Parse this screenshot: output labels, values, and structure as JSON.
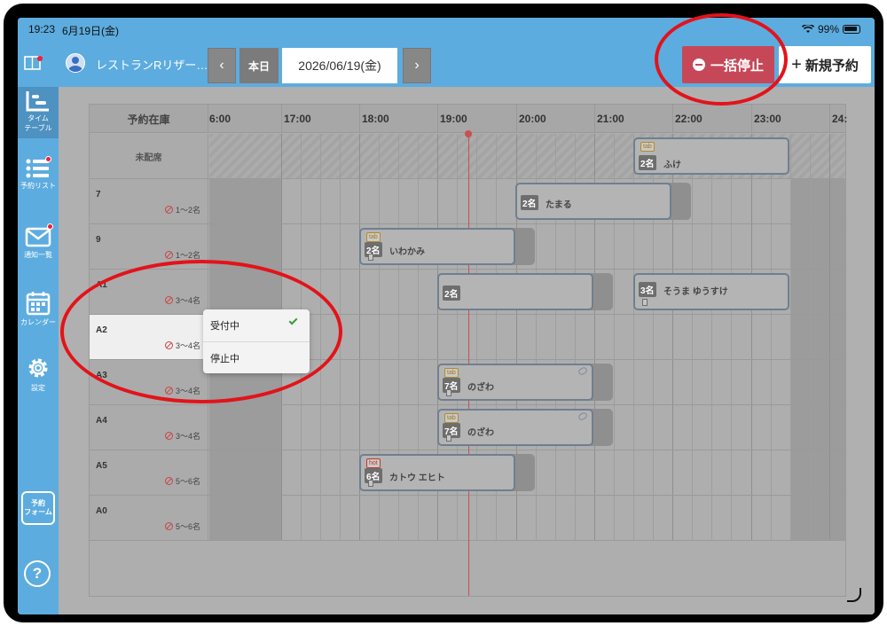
{
  "status_bar": {
    "time": "19:23",
    "date": "6月19日(金)",
    "battery": "99%"
  },
  "header": {
    "restaurant": "レストランRリザー…",
    "prev": "‹",
    "next": "›",
    "today": "本日",
    "date": "2026/06/19(金)",
    "stop_all": "一括停止",
    "new_reservation_plus": "+",
    "new_reservation": "新規予約"
  },
  "sidebar": {
    "items": [
      {
        "label1": "タイム",
        "label2": "テーブル"
      },
      {
        "label1": "予約リスト"
      },
      {
        "label1": "通知一覧"
      },
      {
        "label1": "カレンダー"
      },
      {
        "label1": "設定"
      }
    ],
    "form_button": {
      "line1": "予約",
      "line2": "フォーム"
    },
    "help": "?"
  },
  "timetable": {
    "header_label": "予約在庫",
    "hours": [
      "6:00",
      "17:00",
      "18:00",
      "19:00",
      "20:00",
      "21:00",
      "22:00",
      "23:00",
      "24:"
    ],
    "unassigned_label": "未配席",
    "tables": [
      {
        "name": "7",
        "capacity": "1〜2名"
      },
      {
        "name": "9",
        "capacity": "1〜2名"
      },
      {
        "name": "A1",
        "capacity": "3〜4名"
      },
      {
        "name": "A2",
        "capacity": "3〜4名"
      },
      {
        "name": "A3",
        "capacity": "3〜4名"
      },
      {
        "name": "A4",
        "capacity": "3〜4名"
      },
      {
        "name": "A5",
        "capacity": "5〜6名"
      },
      {
        "name": "A0",
        "capacity": "5〜6名"
      }
    ],
    "bookings": [
      {
        "tag": "tab",
        "people": "2名",
        "name": "ふけ"
      },
      {
        "tag": "",
        "people": "2名",
        "name": "たまる"
      },
      {
        "tag": "tab",
        "people": "2名",
        "name": "いわかみ"
      },
      {
        "tag": "",
        "people": "2名",
        "name": ""
      },
      {
        "tag": "",
        "people": "3名",
        "name": "そうま ゆうすけ"
      },
      {
        "tag": "tab",
        "people": "7名",
        "name": "のざわ"
      },
      {
        "tag": "tab",
        "people": "7名",
        "name": "のざわ"
      },
      {
        "tag": "hot",
        "people": "6名",
        "name": "カトウ エヒト"
      }
    ]
  },
  "dropdown": {
    "accepting": "受付中",
    "stopped": "停止中"
  },
  "colors": {
    "accent_blue": "#5dacdf",
    "stop_red": "#c64858",
    "annotation_red": "#e3131a"
  }
}
